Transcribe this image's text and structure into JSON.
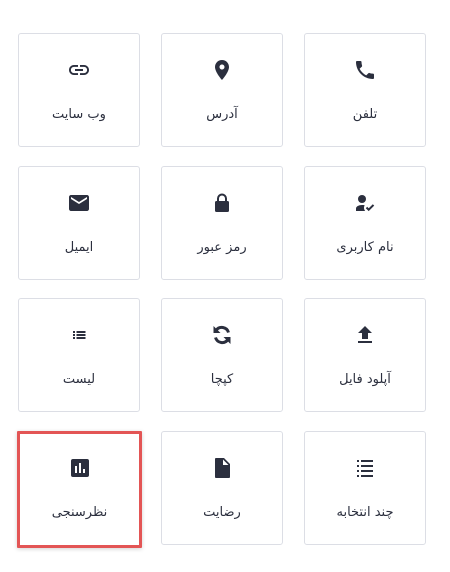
{
  "colors": {
    "icon": "#2b2f3e",
    "text": "#2b2f3e",
    "border": "#dcdee5",
    "selected_border": "#e35555"
  },
  "tiles": [
    {
      "label": "تلفن",
      "icon": "phone-icon"
    },
    {
      "label": "آدرس",
      "icon": "location-pin-icon"
    },
    {
      "label": "وب سایت",
      "icon": "link-icon"
    },
    {
      "label": "نام کاربری",
      "icon": "user-check-icon"
    },
    {
      "label": "رمز عبور",
      "icon": "lock-icon"
    },
    {
      "label": "ایمیل",
      "icon": "mail-icon"
    },
    {
      "label": "آپلود فایل",
      "icon": "upload-icon"
    },
    {
      "label": "کپچا",
      "icon": "refresh-icon"
    },
    {
      "label": "لیست",
      "icon": "list-icon"
    },
    {
      "label": "چند انتخابه",
      "icon": "checklist-icon"
    },
    {
      "label": "رضایت",
      "icon": "document-icon"
    },
    {
      "label": "نظرسنجی",
      "icon": "poll-chart-icon",
      "selected": true
    }
  ]
}
